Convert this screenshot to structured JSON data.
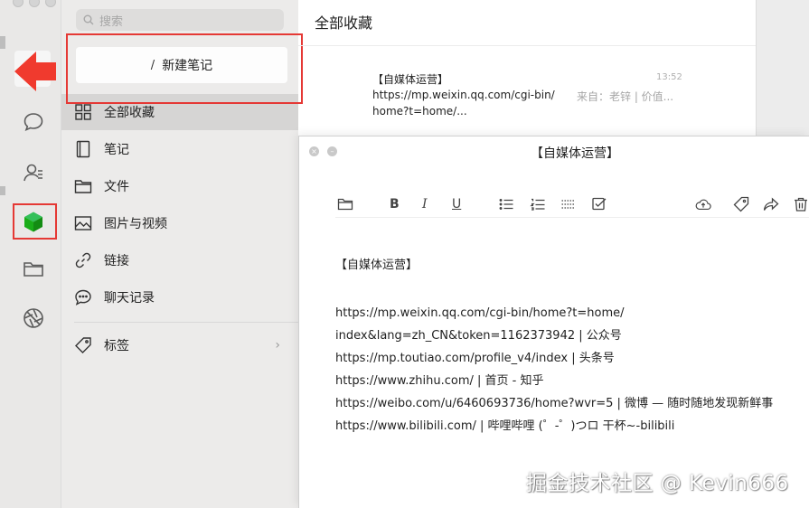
{
  "colors": {
    "highlight": "#e53935",
    "accent_green": "#1aad19"
  },
  "sidebar": {
    "icons": [
      "chat-icon",
      "contacts-icon",
      "favorites-cube-icon",
      "folder-icon",
      "moments-aperture-icon"
    ]
  },
  "panel": {
    "search_placeholder": "搜索",
    "new_note_label": "新建笔记",
    "categories": [
      {
        "label": "全部收藏",
        "icon": "grid-icon"
      },
      {
        "label": "笔记",
        "icon": "notebook-icon"
      },
      {
        "label": "文件",
        "icon": "folder-icon"
      },
      {
        "label": "图片与视频",
        "icon": "image-icon"
      },
      {
        "label": "链接",
        "icon": "link-icon"
      },
      {
        "label": "聊天记录",
        "icon": "chat-bubble-icon"
      }
    ],
    "tags_label": "标签"
  },
  "list": {
    "title": "全部收藏",
    "items": [
      {
        "title": "【自媒体运营】",
        "url_line1": "https://mp.weixin.qq.com/cgi-bin/",
        "url_line2": "home?t=home/...",
        "time": "13:52",
        "source": "来自：老锌 | 价值..."
      }
    ]
  },
  "editor": {
    "title": "【自媒体运营】",
    "heading": "【自媒体运营】",
    "lines": [
      "https://mp.weixin.qq.com/cgi-bin/home?t=home/",
      "index&lang=zh_CN&token=1162373942 | 公众号",
      "https://mp.toutiao.com/profile_v4/index | 头条号",
      "https://www.zhihu.com/ | 首页 - 知乎",
      "https://weibo.com/u/6460693736/home?wvr=5 | 微博 — 随时随地发现新鲜事",
      "https://www.bilibili.com/ | 哔哩哔哩 (゜-゜)つロ 干杯~-bilibili"
    ],
    "toolbar": {
      "bold": "B",
      "italic": "I",
      "underline": "U"
    }
  },
  "watermark": "掘金技术社区 @ Kevin666"
}
